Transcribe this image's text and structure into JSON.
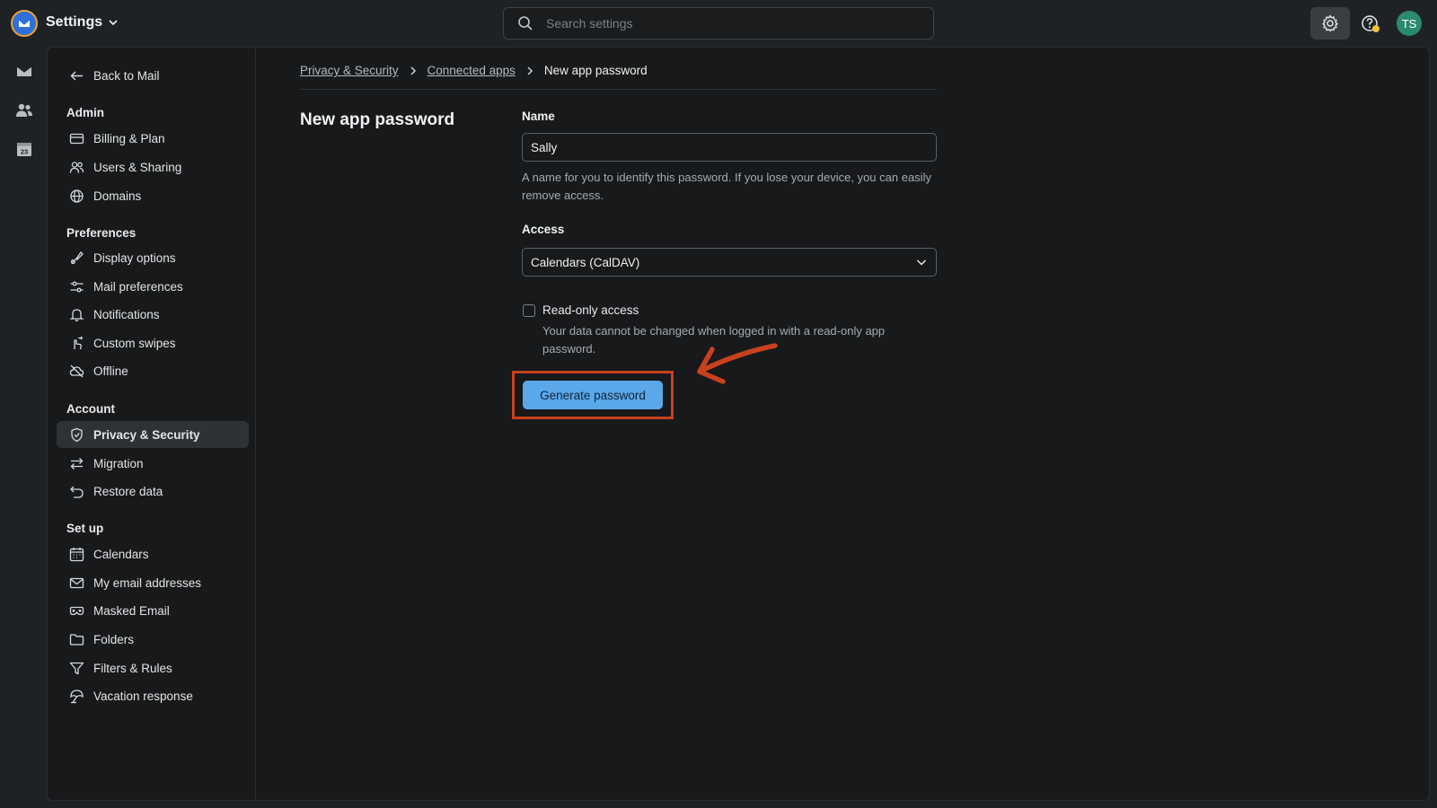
{
  "app": {
    "title": "Settings"
  },
  "search": {
    "placeholder": "Search settings"
  },
  "user": {
    "initials": "TS"
  },
  "sidebar": {
    "back": "Back to Mail",
    "sections": [
      {
        "title": "Admin",
        "items": [
          "Billing & Plan",
          "Users & Sharing",
          "Domains"
        ]
      },
      {
        "title": "Preferences",
        "items": [
          "Display options",
          "Mail preferences",
          "Notifications",
          "Custom swipes",
          "Offline"
        ]
      },
      {
        "title": "Account",
        "items": [
          "Privacy & Security",
          "Migration",
          "Restore data"
        ]
      },
      {
        "title": "Set up",
        "items": [
          "Calendars",
          "My email addresses",
          "Masked Email",
          "Folders",
          "Filters & Rules",
          "Vacation response"
        ]
      }
    ]
  },
  "breadcrumb": {
    "items": [
      "Privacy & Security",
      "Connected apps"
    ],
    "current": "New app password"
  },
  "form": {
    "title": "New app password",
    "name_label": "Name",
    "name_value": "Sally",
    "name_help": "A name for you to identify this password. If you lose your device, you can easily remove access.",
    "access_label": "Access",
    "access_value": "Calendars (CalDAV)",
    "readonly_label": "Read-only access",
    "readonly_help": "Your data cannot be changed when logged in with a read-only app password.",
    "generate_label": "Generate password"
  },
  "colors": {
    "accent": "#5aa7ea",
    "annotation": "#c8411d",
    "active_nav": "#2e3236"
  }
}
